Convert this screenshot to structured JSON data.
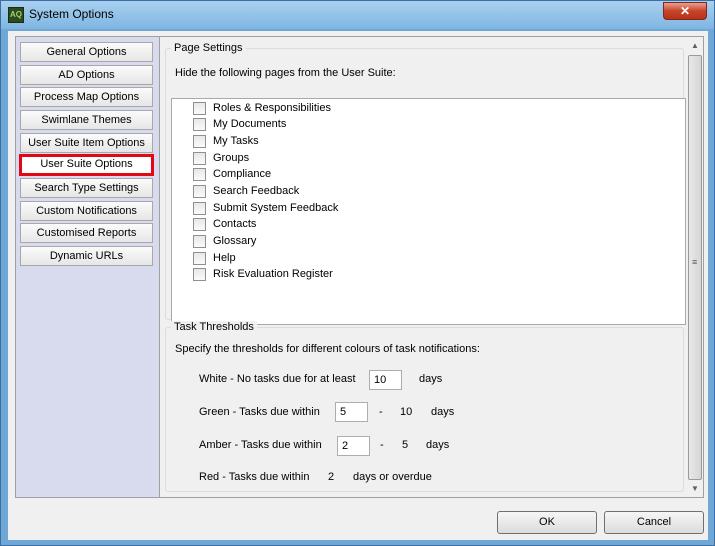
{
  "window": {
    "title": "System Options",
    "app_icon_text": "AQ",
    "close_glyph": "✕"
  },
  "sidebar": {
    "items": [
      {
        "label": "General Options",
        "active": false
      },
      {
        "label": "AD Options",
        "active": false
      },
      {
        "label": "Process Map Options",
        "active": false
      },
      {
        "label": "Swimlane Themes",
        "active": false
      },
      {
        "label": "User Suite Item Options",
        "active": false
      },
      {
        "label": "User Suite Options",
        "active": true
      },
      {
        "label": "Search Type Settings",
        "active": false
      },
      {
        "label": "Custom Notifications",
        "active": false
      },
      {
        "label": "Customised Reports",
        "active": false
      },
      {
        "label": "Dynamic URLs",
        "active": false
      }
    ]
  },
  "page_settings": {
    "group_label": "Page Settings",
    "instruction": "Hide the following pages from the User Suite:",
    "pages": [
      {
        "label": "Roles & Responsibilities",
        "checked": false
      },
      {
        "label": "My Documents",
        "checked": false
      },
      {
        "label": "My Tasks",
        "checked": false
      },
      {
        "label": "Groups",
        "checked": false
      },
      {
        "label": "Compliance",
        "checked": false
      },
      {
        "label": "Search Feedback",
        "checked": false
      },
      {
        "label": "Submit System Feedback",
        "checked": false
      },
      {
        "label": "Contacts",
        "checked": false
      },
      {
        "label": "Glossary",
        "checked": false
      },
      {
        "label": "Help",
        "checked": false
      },
      {
        "label": "Risk Evaluation Register",
        "checked": false
      }
    ]
  },
  "task_thresholds": {
    "group_label": "Task Thresholds",
    "instruction": "Specify the thresholds for different colours of task notifications:",
    "white": {
      "label": "White - No tasks due for at least",
      "value": "10",
      "unit": "days"
    },
    "green": {
      "label": "Green - Tasks due within",
      "value": "5",
      "dash": "-",
      "upper": "10",
      "unit": "days"
    },
    "amber": {
      "label": "Amber - Tasks due within",
      "value": "2",
      "dash": "-",
      "upper": "5",
      "unit": "days"
    },
    "red": {
      "label": "Red - Tasks due within",
      "value": "2",
      "unit": "days or overdue"
    }
  },
  "scrollbar": {
    "up_glyph": "▲",
    "down_glyph": "▼",
    "grip_glyph": "≡"
  },
  "buttons": {
    "ok": "OK",
    "cancel": "Cancel"
  },
  "colors": {
    "active_highlight": "#e30613",
    "title_bar": "#7fb6e2",
    "sidebar_bg": "#d8daee"
  }
}
